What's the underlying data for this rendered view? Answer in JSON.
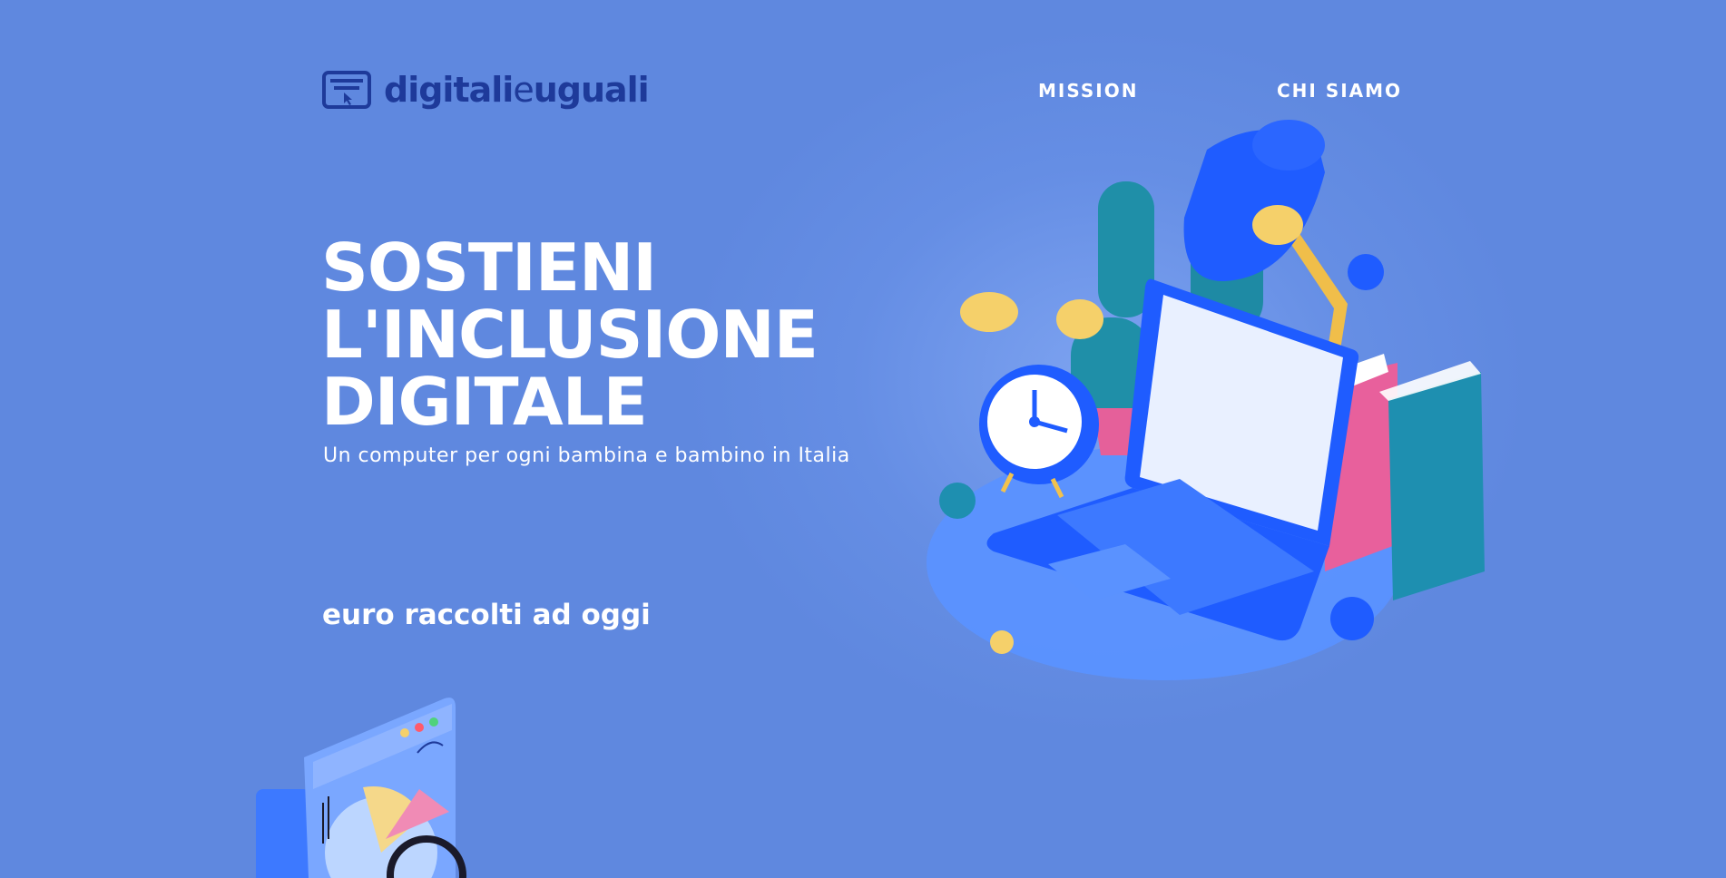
{
  "header": {
    "logo": {
      "text_bold": "digitali",
      "text_thin": "e",
      "text_end": "uguali",
      "icon": "monitor-cursor-icon",
      "color": "#1e3a9a"
    },
    "nav": [
      {
        "label": "MISSION"
      },
      {
        "label": "CHI SIAMO"
      }
    ]
  },
  "hero": {
    "title_lines": [
      "SOSTIENI",
      "L'INCLUSIONE",
      "DIGITALE"
    ],
    "subtitle": "Un computer per ogni bambina e bambino in Italia",
    "raised_label": "euro raccolti ad oggi"
  },
  "illustrations": {
    "desk": "laptop-desk-lamp-cactus-alarm-clock-books-illustration",
    "chart": "browser-window-pie-chart-magnifier-illustration"
  },
  "colors": {
    "background": "#5f88df",
    "text": "#ffffff",
    "logo": "#1e3a9a",
    "accent_blue": "#1f5cff",
    "accent_yellow": "#f4c95a",
    "accent_pink": "#e8609c",
    "accent_teal": "#1e8fb0"
  }
}
